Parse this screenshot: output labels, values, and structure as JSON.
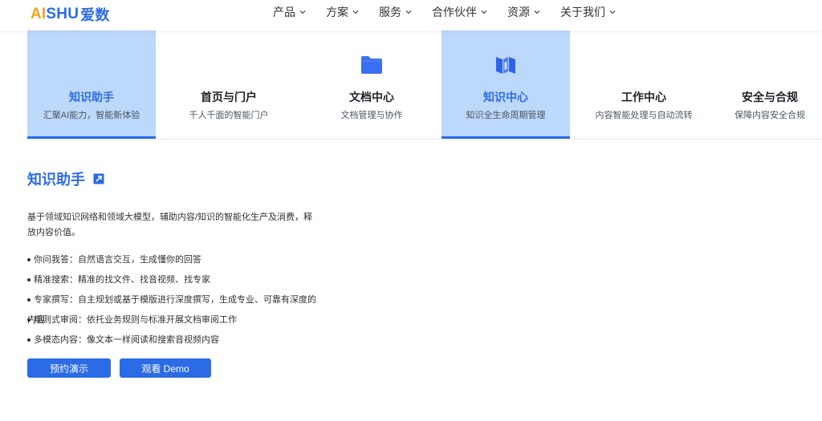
{
  "header": {
    "logo": {
      "part1": "AI",
      "part2": "SHU",
      "part3": "爱数"
    },
    "nav": [
      {
        "label": "产品"
      },
      {
        "label": "方案"
      },
      {
        "label": "服务"
      },
      {
        "label": "合作伙伴"
      },
      {
        "label": "资源"
      },
      {
        "label": "关于我们"
      }
    ]
  },
  "tabs": [
    {
      "title": "知识助手",
      "subtitle": "汇聚AI能力，智能新体验",
      "active": true
    },
    {
      "title": "首页与门户",
      "subtitle": "千人千面的智能门户",
      "active": false
    },
    {
      "title": "文档中心",
      "subtitle": "文档管理与协作",
      "active": false,
      "icon": "folder-icon"
    },
    {
      "title": "知识中心",
      "subtitle": "知识全生命周期管理",
      "active": true,
      "icon": "book-icon"
    },
    {
      "title": "工作中心",
      "subtitle": "内容智能处理与自动流转",
      "active": false
    },
    {
      "title": "安全与合规",
      "subtitle": "保障内容安全合规",
      "active": false
    }
  ],
  "content": {
    "title": "知识助手",
    "description": "基于领域知识网络和领域大模型，辅助内容/知识的智能化生产及消费，释放内容价值。",
    "bullets": [
      "你问我答：自然语言交互，生成懂你的回答",
      "精准搜索：精准的找文件、找音视频、找专家",
      "专家撰写：自主规划或基于模版进行深度撰写，生成专业、可靠有深度的内容",
      "规则式审阅：依托业务规则与标准开展文档审阅工作",
      "多模态内容：像文本一样阅读和搜索音视频内容"
    ],
    "buttons": {
      "primary": "预约演示",
      "secondary": "观看 Demo"
    }
  },
  "colors": {
    "brand": "#2b6be6",
    "accent": "#f3a21b",
    "active_tab_bg": "#bcd8fb"
  }
}
